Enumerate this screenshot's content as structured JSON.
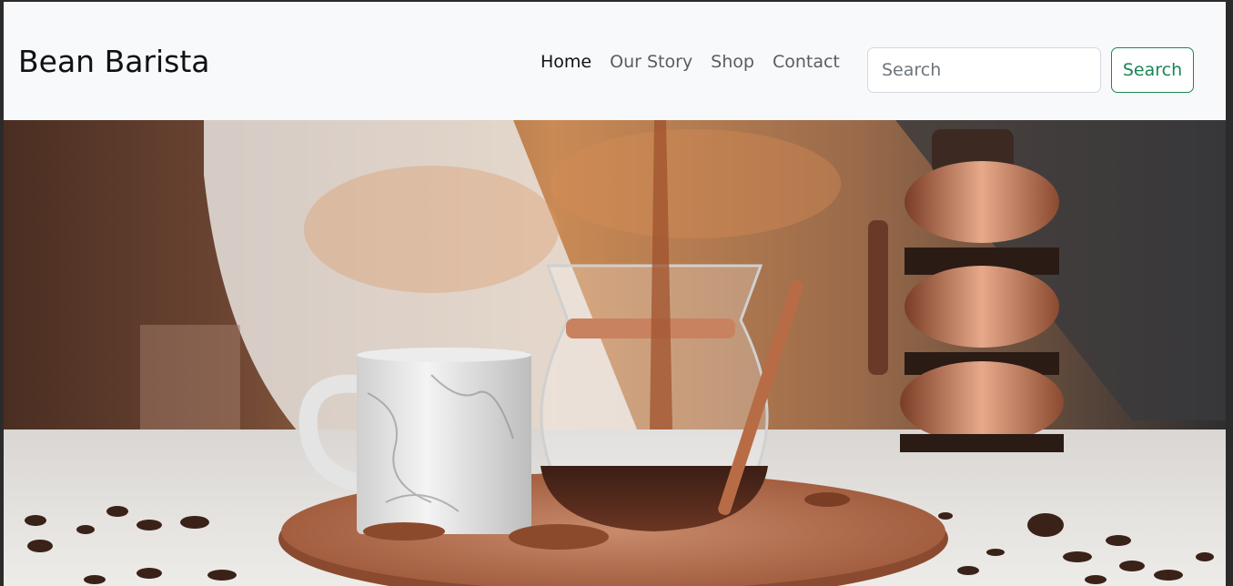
{
  "navbar": {
    "brand": "Bean Barista",
    "links": [
      {
        "label": "Home",
        "active": true
      },
      {
        "label": "Our Story",
        "active": false
      },
      {
        "label": "Shop",
        "active": false
      },
      {
        "label": "Contact",
        "active": false
      }
    ],
    "search": {
      "placeholder": "Search",
      "value": ""
    },
    "search_button": "Search"
  },
  "colors": {
    "navbar_bg": "#f8f9fa",
    "search_accent": "#198754",
    "copper": "#c9825d"
  },
  "hero": {
    "image": "coffee-pour-over-scene"
  }
}
